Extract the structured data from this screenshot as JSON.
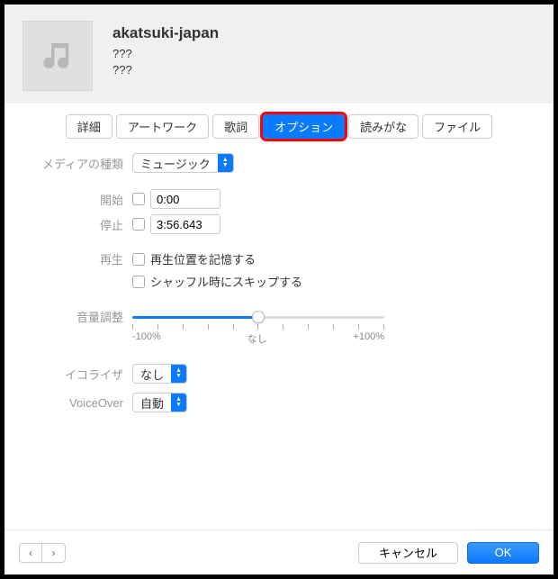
{
  "header": {
    "title": "akatsuki-japan",
    "artist": "???",
    "album": "???"
  },
  "tabs": {
    "detail": "詳細",
    "artwork": "アートワーク",
    "lyrics": "歌詞",
    "options": "オプション",
    "sort": "読みがな",
    "file": "ファイル"
  },
  "form": {
    "media_type_label": "メディアの種類",
    "media_type_value": "ミュージック",
    "start_label": "開始",
    "start_value": "0:00",
    "stop_label": "停止",
    "stop_value": "3:56.643",
    "playback_label": "再生",
    "remember_position": "再生位置を記憶する",
    "skip_shuffle": "シャッフル時にスキップする",
    "volume_label": "音量調整",
    "volume_min": "-100%",
    "volume_center": "なし",
    "volume_max": "+100%",
    "eq_label": "イコライザ",
    "eq_value": "なし",
    "voiceover_label": "VoiceOver",
    "voiceover_value": "自動"
  },
  "footer": {
    "prev": "‹",
    "next": "›",
    "cancel": "キャンセル",
    "ok": "OK"
  }
}
